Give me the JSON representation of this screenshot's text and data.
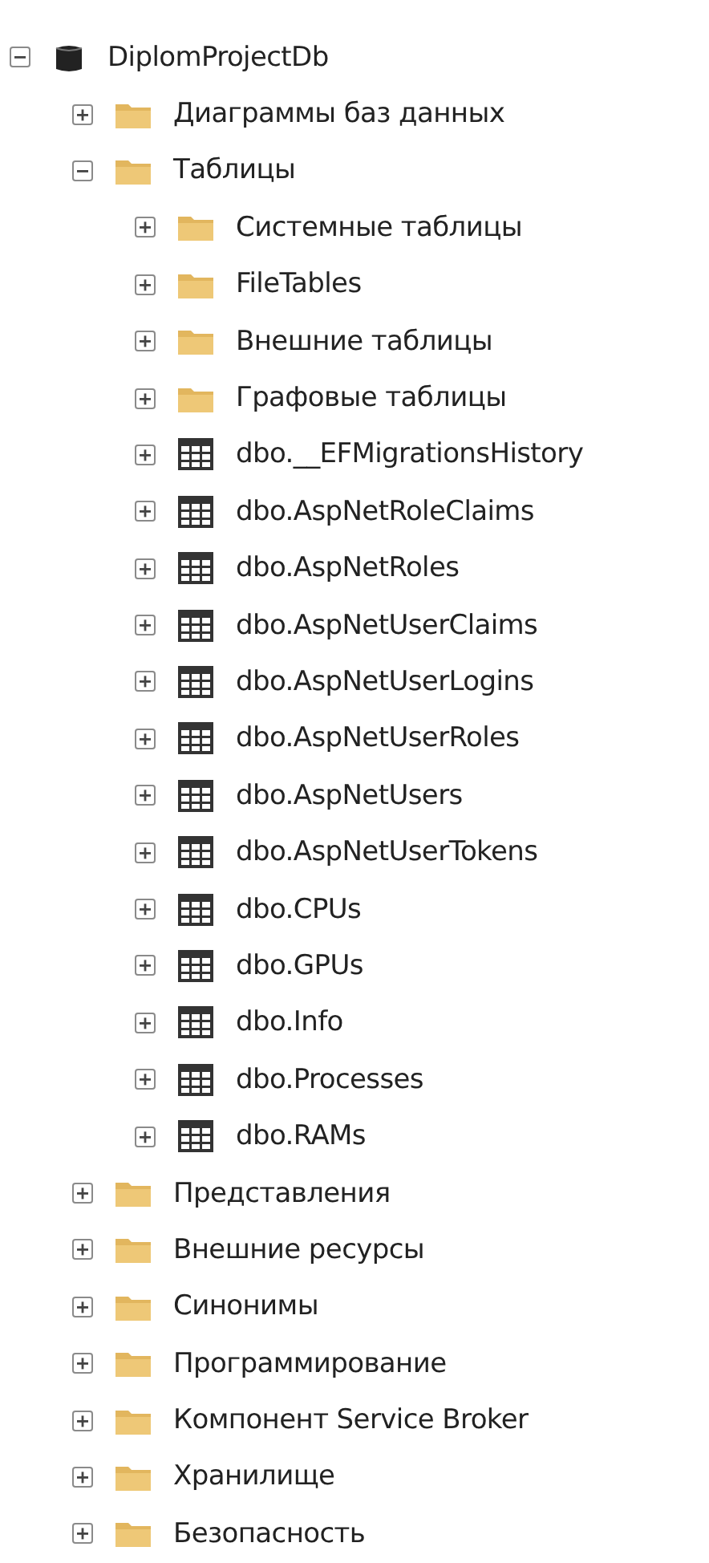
{
  "tree": [
    {
      "label": "DiplomProjectDb",
      "kind": "database",
      "expanded": true,
      "children": [
        {
          "label": "Диаграммы баз данных",
          "kind": "folder",
          "expanded": false
        },
        {
          "label": "Таблицы",
          "kind": "folder",
          "expanded": true,
          "children": [
            {
              "label": "Системные таблицы",
              "kind": "folder",
              "expanded": false
            },
            {
              "label": "FileTables",
              "kind": "folder",
              "expanded": false
            },
            {
              "label": "Внешние таблицы",
              "kind": "folder",
              "expanded": false
            },
            {
              "label": "Графовые таблицы",
              "kind": "folder",
              "expanded": false
            },
            {
              "label": "dbo.__EFMigrationsHistory",
              "kind": "table",
              "expanded": false
            },
            {
              "label": "dbo.AspNetRoleClaims",
              "kind": "table",
              "expanded": false
            },
            {
              "label": "dbo.AspNetRoles",
              "kind": "table",
              "expanded": false
            },
            {
              "label": "dbo.AspNetUserClaims",
              "kind": "table",
              "expanded": false
            },
            {
              "label": "dbo.AspNetUserLogins",
              "kind": "table",
              "expanded": false
            },
            {
              "label": "dbo.AspNetUserRoles",
              "kind": "table",
              "expanded": false
            },
            {
              "label": "dbo.AspNetUsers",
              "kind": "table",
              "expanded": false
            },
            {
              "label": "dbo.AspNetUserTokens",
              "kind": "table",
              "expanded": false
            },
            {
              "label": "dbo.CPUs",
              "kind": "table",
              "expanded": false
            },
            {
              "label": "dbo.GPUs",
              "kind": "table",
              "expanded": false
            },
            {
              "label": "dbo.Info",
              "kind": "table",
              "expanded": false
            },
            {
              "label": "dbo.Processes",
              "kind": "table",
              "expanded": false
            },
            {
              "label": "dbo.RAMs",
              "kind": "table",
              "expanded": false
            }
          ]
        },
        {
          "label": "Представления",
          "kind": "folder",
          "expanded": false
        },
        {
          "label": "Внешние ресурсы",
          "kind": "folder",
          "expanded": false
        },
        {
          "label": "Синонимы",
          "kind": "folder",
          "expanded": false
        },
        {
          "label": "Программирование",
          "kind": "folder",
          "expanded": false
        },
        {
          "label": "Компонент Service Broker",
          "kind": "folder",
          "expanded": false
        },
        {
          "label": "Хранилище",
          "kind": "folder",
          "expanded": false
        },
        {
          "label": "Безопасность",
          "kind": "folder",
          "expanded": false
        }
      ]
    }
  ]
}
